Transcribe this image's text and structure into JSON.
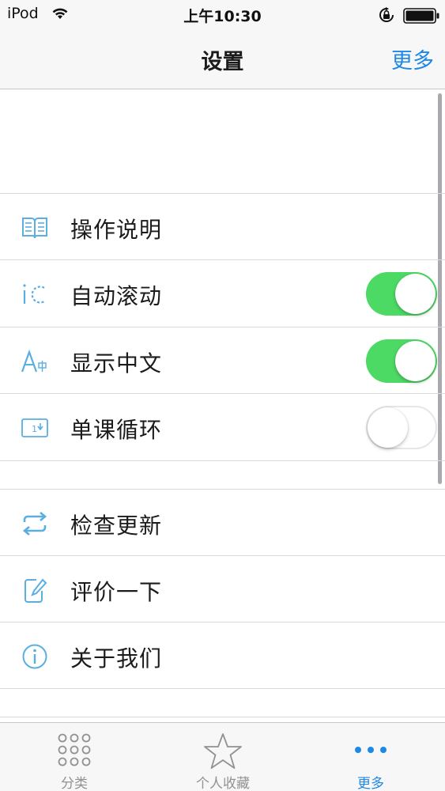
{
  "status_bar": {
    "carrier": "iPod",
    "time": "上午10:30"
  },
  "nav": {
    "title": "设置",
    "right_button": "更多"
  },
  "settings": {
    "group1": [
      {
        "label": "操作说明",
        "icon": "book-icon"
      },
      {
        "label": "自动滚动",
        "icon": "auto-scroll-icon",
        "toggle": true
      },
      {
        "label": "显示中文",
        "icon": "chinese-text-icon",
        "toggle": true
      },
      {
        "label": "单课循环",
        "icon": "repeat-one-icon",
        "toggle": false
      }
    ],
    "group2": [
      {
        "label": "检查更新",
        "icon": "refresh-icon"
      },
      {
        "label": "评价一下",
        "icon": "edit-icon"
      },
      {
        "label": "关于我们",
        "icon": "info-icon"
      }
    ]
  },
  "tab_bar": {
    "tabs": [
      {
        "label": "分类",
        "icon": "grid-dots-icon",
        "active": false
      },
      {
        "label": "个人收藏",
        "icon": "star-icon",
        "active": false
      },
      {
        "label": "更多",
        "icon": "more-dots-icon",
        "active": true
      }
    ]
  },
  "colors": {
    "accent": "#1e88e5",
    "toggle_on": "#4cd964",
    "icon_blue": "#5aaee0",
    "tab_inactive": "#929292"
  }
}
